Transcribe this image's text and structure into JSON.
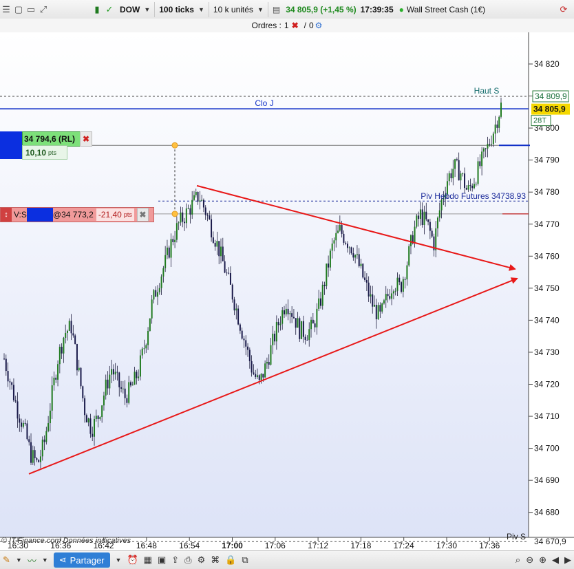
{
  "toolbar": {
    "instrument": "DOW",
    "ticks": "100 ticks",
    "units": "10 k unités",
    "price_change": "34 805,9 (+1,45 %)",
    "time": "17:39:35",
    "market_name": "Wall Street Cash (1€)"
  },
  "orders": {
    "label": "Ordres :",
    "count_a": "1",
    "separator": "/",
    "count_b": "0"
  },
  "order_long": {
    "price": "34 794,6 (RL)",
    "pts": "10,10",
    "pts_unit": "pts"
  },
  "order_short": {
    "prefix": "V:S",
    "price": "@34 773,2",
    "pts": "-21,40",
    "pts_unit": "pts"
  },
  "labels": {
    "clo_j": "Clo J",
    "haut_s": "Haut S",
    "piv_hebdo": "Piv Hebdo Futures 34738.93",
    "piv_s": "Piv S",
    "copyright": "© IT-Finance.com  Données indicatives",
    "price_tag_haut": "34 809,9",
    "price_tag_last": "34 805,9",
    "price_tag_piv": "34 670,9",
    "countdown": "28T"
  },
  "bottom": {
    "share_label": "Partager"
  },
  "colors": {
    "bull": "#1f7a1f",
    "bear": "#1a1a4a",
    "trend": "#e81818",
    "clo_line": "#1030c8",
    "long_green": "#7de07a",
    "short_red": "#f09a9a",
    "accent_blue": "#0b2fe0",
    "price_tag": "#f5d800"
  },
  "chart_data": {
    "type": "candlestick",
    "ylim": [
      34665,
      34825
    ],
    "y_ticks": [
      "34 680",
      "34 690",
      "34 700",
      "34 710",
      "34 720",
      "34 730",
      "34 740",
      "34 750",
      "34 760",
      "34 770",
      "34 780",
      "34 790",
      "34 800",
      "34 810",
      "34 820"
    ],
    "x_ticks": [
      "16:30",
      "16:36",
      "16:42",
      "16:48",
      "16:54",
      "17:00",
      "17:06",
      "17:12",
      "17:18",
      "17:24",
      "17:30",
      "17:36"
    ],
    "levels": {
      "clo_j": 34806,
      "haut_s": 34809.9,
      "piv_hebdo": 34777.2,
      "piv_s": 34670.9,
      "order_long": 34794.6,
      "order_short": 34773.2,
      "last": 34805.9
    },
    "trendlines": [
      {
        "from": [
          34782,
          34782
        ],
        "to_x": "right",
        "value_end": 34756
      },
      {
        "from": [
          34692,
          34692
        ],
        "to_x": "right",
        "value_end": 34753
      }
    ],
    "path_values": [
      34728,
      34720,
      34712,
      34706,
      34698,
      34695,
      34702,
      34715,
      34728,
      34736,
      34738,
      34725,
      34712,
      34706,
      34710,
      34718,
      34725,
      34720,
      34716,
      34719,
      34724,
      34733,
      34745,
      34752,
      34758,
      34765,
      34770,
      34773,
      34776,
      34779,
      34774,
      34768,
      34762,
      34755,
      34748,
      34740,
      34732,
      34724,
      34720,
      34726,
      34733,
      34740,
      34746,
      34742,
      34737,
      34736,
      34738,
      34745,
      34755,
      34764,
      34768,
      34765,
      34762,
      34756,
      34750,
      34744,
      34741,
      34747,
      34752,
      34750,
      34758,
      34768,
      34773,
      34770,
      34764,
      34776,
      34784,
      34788,
      34786,
      34780,
      34784,
      34789,
      34794,
      34800,
      34807
    ]
  }
}
